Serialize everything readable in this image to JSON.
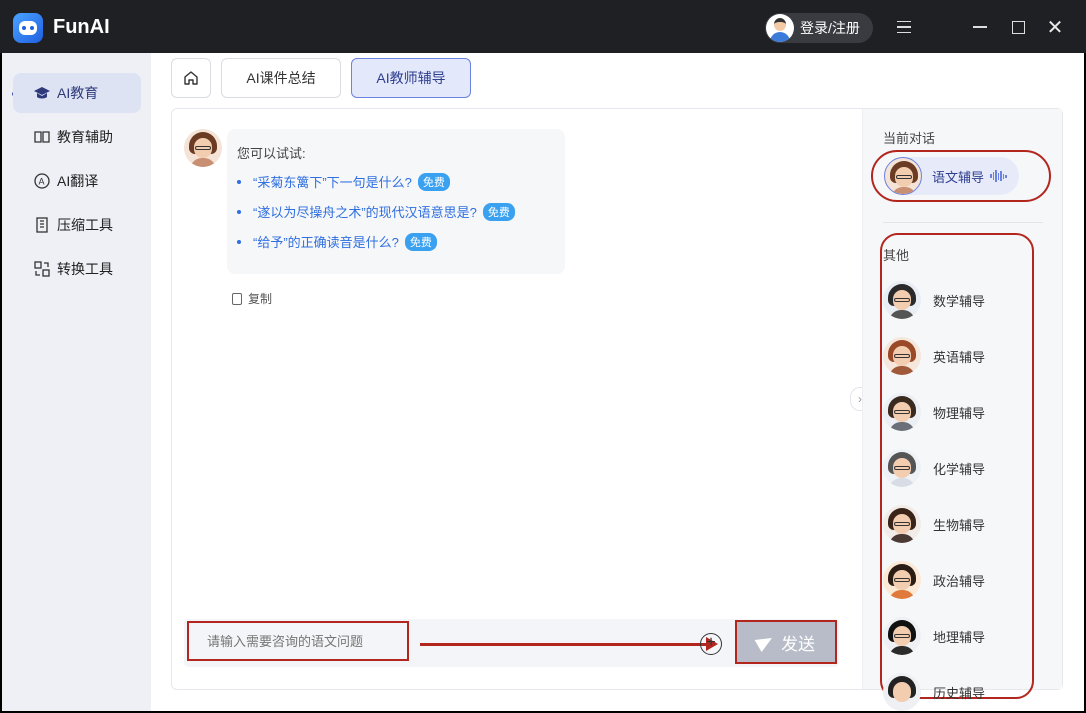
{
  "titlebar": {
    "app_name": "FunAI",
    "login_label": "登录/注册"
  },
  "sidebar": {
    "items": [
      {
        "label": "AI教育",
        "icon": "graduation-cap-icon",
        "active": true
      },
      {
        "label": "教育辅助",
        "icon": "book-icon",
        "active": false
      },
      {
        "label": "AI翻译",
        "icon": "translate-icon",
        "active": false
      },
      {
        "label": "压缩工具",
        "icon": "compress-icon",
        "active": false
      },
      {
        "label": "转换工具",
        "icon": "convert-icon",
        "active": false
      }
    ]
  },
  "tabs": [
    {
      "label": "AI课件总结",
      "active": false
    },
    {
      "label": "AI教师辅导",
      "active": true
    }
  ],
  "chat": {
    "prompt_title": "您可以试试:",
    "suggestions": [
      {
        "text": "“采菊东篱下”下一句是什么?",
        "badge": "免费"
      },
      {
        "text": "“遂以为尽操舟之术”的现代汉语意思是?",
        "badge": "免费"
      },
      {
        "text": "“给予”的正确读音是什么?",
        "badge": "免费"
      }
    ],
    "copy_label": "复制"
  },
  "input": {
    "placeholder": "请输入需要咨询的语文问题",
    "send_label": "发送"
  },
  "right_panel": {
    "current_title": "当前对话",
    "current_tutor": "语文辅导",
    "others_title": "其他",
    "others": [
      {
        "label": "数学辅导"
      },
      {
        "label": "英语辅导"
      },
      {
        "label": "物理辅导"
      },
      {
        "label": "化学辅导"
      },
      {
        "label": "生物辅导"
      },
      {
        "label": "政治辅导"
      },
      {
        "label": "地理辅导"
      },
      {
        "label": "历史辅导"
      }
    ]
  },
  "colors": {
    "accent": "#2f6fe0",
    "annotation_red": "#b3261e",
    "badge_blue": "#3aa0f0"
  }
}
